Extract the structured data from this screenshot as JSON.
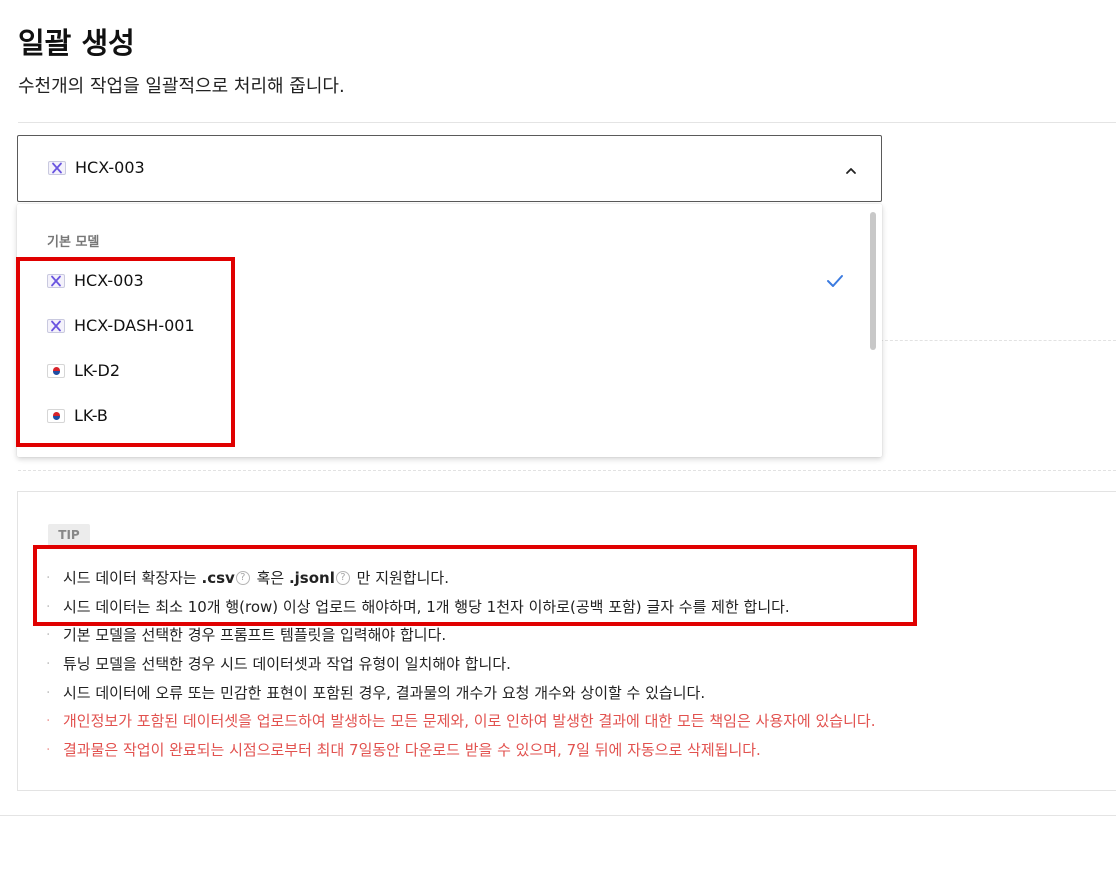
{
  "header": {
    "title": "일괄 생성",
    "subtitle": "수천개의 작업을 일괄적으로 처리해 줍니다."
  },
  "model_select": {
    "selected_label": "HCX-003",
    "group_label": "기본 모델",
    "options": [
      {
        "label": "HCX-003",
        "icon": "hcx-x-icon",
        "selected": true
      },
      {
        "label": "HCX-DASH-001",
        "icon": "hcx-x-icon",
        "selected": false
      },
      {
        "label": "LK-D2",
        "icon": "korea-flag-icon",
        "selected": false
      },
      {
        "label": "LK-B",
        "icon": "korea-flag-icon",
        "selected": false
      }
    ]
  },
  "tip": {
    "badge": "TIP",
    "bullet": "·",
    "help": "?",
    "line1": {
      "part1": "시드 데이터 확장자는 ",
      "csv": ".csv",
      "part2": " 혹은 ",
      "jsonl": ".jsonl",
      "part3": " 만 지원합니다."
    },
    "line2": "시드 데이터는 최소 10개 행(row) 이상 업로드 해야하며, 1개 행당 1천자 이하로(공백 포함) 글자 수를 제한 합니다.",
    "line3": "기본 모델을 선택한 경우 프롬프트 템플릿을 입력해야 합니다.",
    "line4": "튜닝 모델을 선택한 경우 시드 데이터셋과 작업 유형이 일치해야 합니다.",
    "line5": "시드 데이터에 오류 또는 민감한 표현이 포함된 경우, 결과물의 개수가 요청 개수와 상이할 수 있습니다.",
    "line6": "개인정보가 포함된 데이터셋을 업로드하여 발생하는 모든 문제와, 이로 인하여 발생한 결과에 대한 모든 책임은 사용자에 있습니다.",
    "line7": "결과물은 작업이 완료되는 시점으로부터 최대 7일동안 다운로드 받을 수 있으며, 7일 뒤에 자동으로 삭제됩니다."
  },
  "colors": {
    "warning_text": "#e2524f",
    "check_accent": "#3b7be0",
    "highlight_box": "#e00000"
  }
}
